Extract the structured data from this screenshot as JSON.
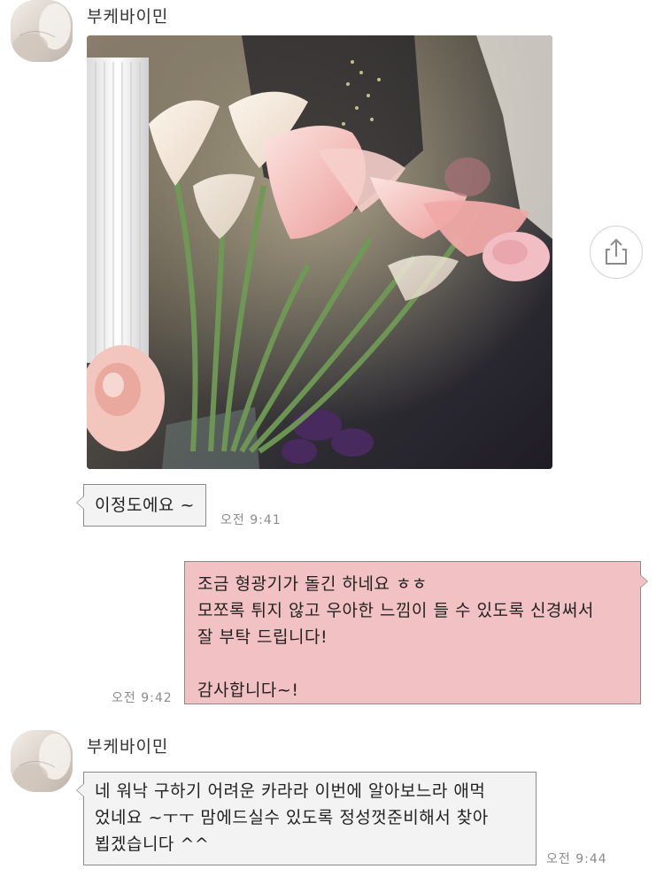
{
  "colors": {
    "incoming_bubble": "#f3f3f3",
    "outgoing_bubble": "#f1c1c4",
    "bubble_border": "#8a8a8a",
    "timestamp": "#8b8b8b"
  },
  "messages": [
    {
      "sender": "부케바이민",
      "type": "image",
      "image_icon": "photo-of-calla-lilies"
    },
    {
      "type": "text",
      "direction": "incoming",
      "text": "이정도에요 ~",
      "time": "오전 9:41"
    },
    {
      "type": "text",
      "direction": "outgoing",
      "lines": [
        "조금 형광기가 돌긴 하네요 ㅎㅎ",
        "모쪼록 튀지 않고 우아한 느낌이 들 수 있도록 신경써서",
        "잘 부탁 드립니다!",
        "",
        "감사합니다~!"
      ],
      "time": "오전 9:42"
    },
    {
      "sender": "부케바이민",
      "type": "text",
      "direction": "incoming",
      "lines": [
        "네 워낙 구하기 어려운 카라라 이번에 알아보느라 애먹",
        "었네요 ~ㅜㅜ 맘에드실수 있도록 정성껏준비해서 찾아",
        "뵙겠습니다 ^^"
      ],
      "time": "오전 9:44"
    }
  ],
  "share_icon": "share-icon"
}
